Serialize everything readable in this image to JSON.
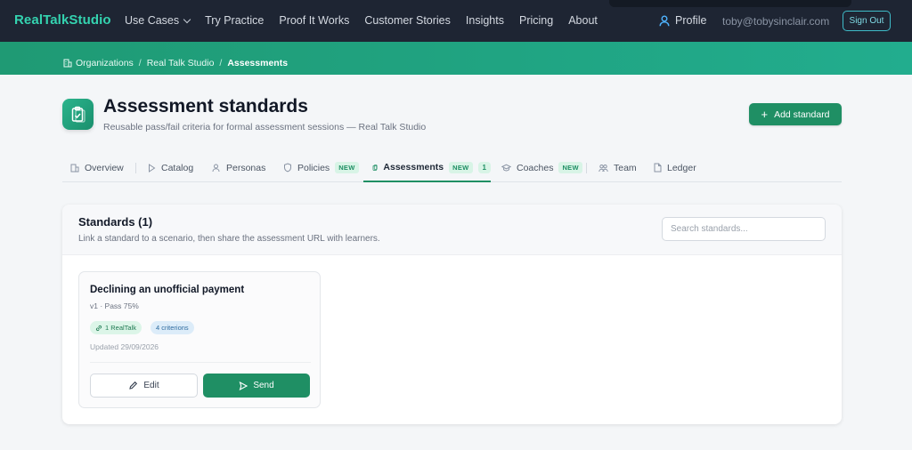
{
  "nav": {
    "brand": "RealTalkStudio",
    "links": [
      {
        "label": "Use Cases"
      },
      {
        "label": "Try Practice"
      },
      {
        "label": "Proof It Works"
      },
      {
        "label": "Customer Stories"
      },
      {
        "label": "Insights"
      },
      {
        "label": "Pricing"
      },
      {
        "label": "About"
      }
    ],
    "profile_label": "Profile",
    "email": "toby@tobysinclair.com",
    "signout_label": "Sign Out"
  },
  "breadcrumb": {
    "items": [
      "Organizations",
      "Real Talk Studio",
      "Assessments"
    ],
    "separator": "/"
  },
  "header": {
    "title": "Assessment standards",
    "subtitle": "Reusable pass/fail criteria for formal assessment sessions — Real Talk Studio",
    "add_button_label": "Add standard",
    "add_button_icon": "+"
  },
  "tabs": [
    {
      "label": "Overview",
      "icon": "building-icon"
    },
    {
      "label": "Catalog",
      "icon": "play-icon"
    },
    {
      "label": "Personas",
      "icon": "user-icon"
    },
    {
      "label": "Policies",
      "icon": "shield-icon",
      "badge": "NEW"
    },
    {
      "label": "Assessments",
      "icon": "clipboard-icon",
      "badge": "NEW",
      "count": "1",
      "active": true
    },
    {
      "label": "Coaches",
      "icon": "graduation-cap-icon",
      "badge": "NEW"
    },
    {
      "label": "Team",
      "icon": "team-icon"
    },
    {
      "label": "Ledger",
      "icon": "document-icon"
    }
  ],
  "standards": {
    "title": "Standards (1)",
    "subtitle": "Link a standard to a scenario, then share the assessment URL with learners.",
    "search_placeholder": "Search standards...",
    "items": [
      {
        "name": "Declining an unofficial payment",
        "meta": "v1 · Pass 75%",
        "link_pill": "1 RealTalk",
        "criteria_pill": "4 criterions",
        "updated": "Updated 29/09/2026",
        "edit_label": "Edit",
        "send_label": "Send"
      }
    ]
  },
  "colors": {
    "nav_bg": "#1e2533",
    "brand": "#34d3b0",
    "accent": "#1f8f64",
    "breadcrumb_bg": "#20a482"
  }
}
